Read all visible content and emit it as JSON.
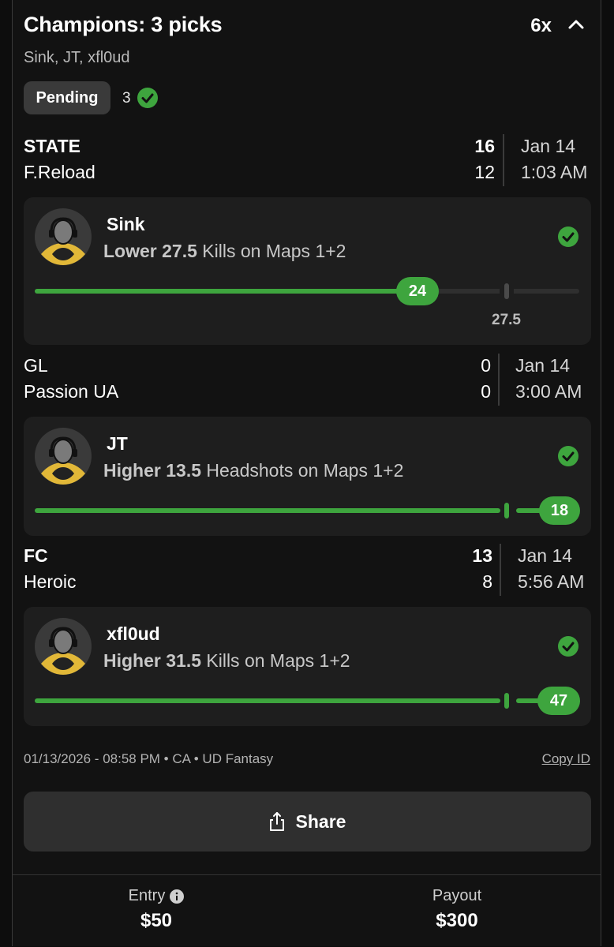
{
  "header": {
    "title": "Champions: 3 picks",
    "multiplier": "6x",
    "collapse_icon": "chevron-up-icon",
    "subtitle": "Sink, JT, xfl0ud",
    "status": "Pending",
    "correct_count": "3"
  },
  "games": [
    {
      "team1": "STATE",
      "score1": "16",
      "team2": "F.Reload",
      "score2": "12",
      "date": "Jan 14",
      "time": "1:03 AM"
    },
    {
      "team1": "GL",
      "score1": "0",
      "team2": "Passion UA",
      "score2": "0",
      "date": "Jan 14",
      "time": "3:00 AM"
    },
    {
      "team1": "FC",
      "score1": "13",
      "team2": "Heroic",
      "score2": "8",
      "date": "Jan 14",
      "time": "5:56 AM"
    }
  ],
  "picks": [
    {
      "player": "Sink",
      "direction": "Lower 27.5",
      "stat": "Kills on Maps 1+2",
      "line": 27.5,
      "line_label": "27.5",
      "actual": "24",
      "result": "check-icon"
    },
    {
      "player": "JT",
      "direction": "Higher 13.5",
      "stat": "Headshots on Maps 1+2",
      "line": 13.5,
      "actual": "18",
      "result": "check-icon"
    },
    {
      "player": "xfl0ud",
      "direction": "Higher 31.5",
      "stat": "Kills on Maps 1+2",
      "line": 31.5,
      "actual": "47",
      "result": "check-icon"
    }
  ],
  "meta": {
    "info": "01/13/2026 - 08:58 PM • CA • UD Fantasy",
    "copy_id": "Copy ID"
  },
  "share": {
    "label": "Share"
  },
  "footer": {
    "entry_label": "Entry",
    "entry_value": "$50",
    "payout_label": "Payout",
    "payout_value": "$300"
  },
  "colors": {
    "accent_green": "#3ea53e",
    "background": "#121212",
    "card": "#1e1e1e"
  }
}
